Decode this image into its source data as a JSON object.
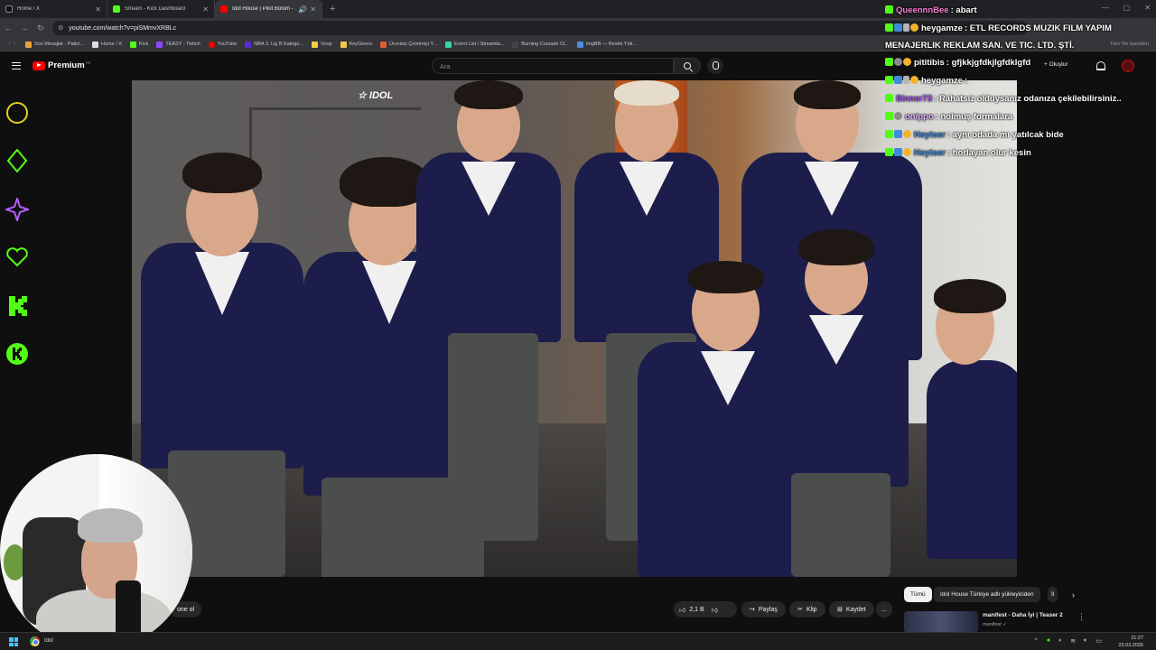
{
  "browser": {
    "tabs": [
      {
        "title": "Home / X",
        "color": "#111111"
      },
      {
        "title": "Stream - Kick Dashboard",
        "color": "#53fc18"
      },
      {
        "title": "Idol House | Pilot Bölüm - ...",
        "color": "#ff0000"
      }
    ],
    "new_tab": "+",
    "url": "youtube.com/watch?v=piSMmvXRBLc",
    "bookmarks": [
      {
        "label": "Son Mesajlar - Patici...",
        "color": "#e8a23c"
      },
      {
        "label": "Home / X",
        "color": "#dddddd"
      },
      {
        "label": "Kick",
        "color": "#53fc18"
      },
      {
        "label": "TEASY - Twitch",
        "color": "#9146ff"
      },
      {
        "label": "YouTube",
        "color": "#ff0000"
      },
      {
        "label": "NBA 3. Lig B Katego...",
        "color": "#5a2bd6"
      },
      {
        "label": "Voop",
        "color": "#f2c94c"
      },
      {
        "label": "KeyGivers",
        "color": "#f2c94c"
      },
      {
        "label": "Ücretsiz Çevrimiçi Y...",
        "color": "#e05a3b"
      },
      {
        "label": "Event List / Streamla...",
        "color": "#38d39f"
      },
      {
        "label": "Burning Crusade Cl...",
        "color": "#444444"
      },
      {
        "label": "ImgBB — Resim Yük...",
        "color": "#4a90e2"
      }
    ],
    "bookmarks_right": "Tüm Yer İşaretleri"
  },
  "youtube": {
    "logo_text": "Premium",
    "logo_sup": "TR",
    "search_placeholder": "Ara",
    "create_label": "+ Oluştur"
  },
  "video_actions": {
    "subscribe_fragment": "one ol",
    "likes": "2,1 B",
    "share": "Paylaş",
    "clip": "Klip",
    "save": "Kaydet",
    "more": "..."
  },
  "chips": {
    "all": "Tümü",
    "uploader": "Idol House Türkiye adlı yükleyiciden",
    "partial": "İl"
  },
  "recommendation": {
    "title": "manifest - Daha İyi | Teaser 2",
    "channel": "manifest ✓"
  },
  "chat": [
    {
      "user": "QueennnBee",
      "user_color": "#ff7bd5",
      "text": ": abart",
      "badges": [
        "k"
      ]
    },
    {
      "user": "heygamze",
      "user_color": "#ffffff",
      "text": ": ETL RECORDS MUZIK FILM YAPIM MENAJERLIK REKLAM SAN. VE TIC. LTD. ŞTİ.",
      "badges": [
        "k",
        "blue",
        "sword",
        "gold"
      ],
      "wrap": true
    },
    {
      "user": "pititibis",
      "user_color": "#ffffff",
      "text": ": gfjkkjgfdkjlgfdklgfd",
      "badges": [
        "k",
        "grey",
        "gold"
      ]
    },
    {
      "user": "heygamze",
      "user_color": "#ffffff",
      "text": ":",
      "badges": [
        "k",
        "blue",
        "sword",
        "gold"
      ]
    },
    {
      "user": "Sinner73",
      "user_color": "#a855f7",
      "text": ": Rahatsız olduysanız odanıza çekilebilirsiniz..",
      "badges": [
        "k"
      ]
    },
    {
      "user": "onippo",
      "user_color": "#d8b4fe",
      "text": ": nolmuş formalara",
      "badges": [
        "k",
        "grey"
      ]
    },
    {
      "user": "Heytser",
      "user_color": "#3e8bd9",
      "text": ": aynı odada mı yatılcak bide",
      "badges": [
        "k",
        "blue",
        "gold"
      ]
    },
    {
      "user": "Heytser",
      "user_color": "#3e8bd9",
      "text": ": horlayan olur kesin",
      "badges": [
        "k",
        "blue",
        "gold"
      ]
    }
  ],
  "side_icons": [
    {
      "name": "circle-icon",
      "color": "#e0d21a"
    },
    {
      "name": "diamond-icon",
      "color": "#53fc18"
    },
    {
      "name": "star-icon",
      "color": "#b65cff"
    },
    {
      "name": "heart-icon",
      "color": "#53fc18"
    },
    {
      "name": "kick-k-icon",
      "color": "#53fc18"
    },
    {
      "name": "kick-circle-icon",
      "color": "#53fc18"
    }
  ],
  "taskbar": {
    "app_label": "Idol",
    "time": "21:27",
    "date": "23.03.2026"
  }
}
